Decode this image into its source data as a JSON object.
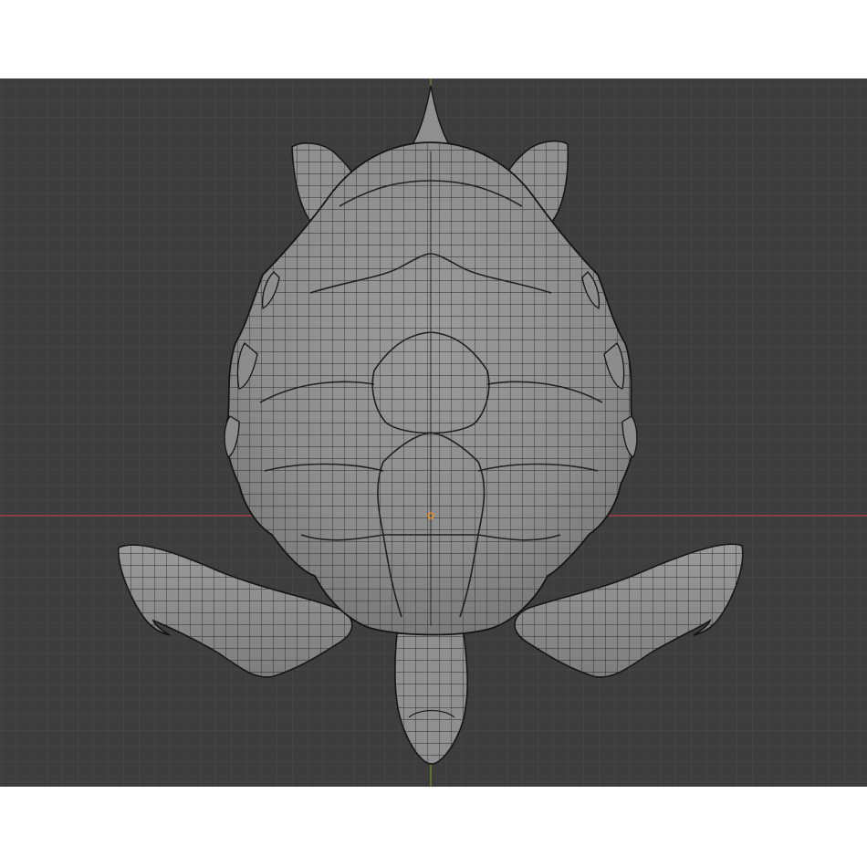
{
  "viewport": {
    "background_color": "#3d3d3d",
    "grid_minor_color": "#474747",
    "grid_major_color": "#515151",
    "x_axis_color": "#b3424b",
    "y_axis_color": "#6a8f2c",
    "mesh_fill_color": "#8e8e8e",
    "mesh_wire_color": "#2a2a2a",
    "mesh_outline_color": "#141414",
    "origin_marker_color": "#e98a2b",
    "view": "top-orthographic",
    "display_mode": "solid-with-wireframe-overlay"
  },
  "object": {
    "name": "turtle-mesh",
    "selected": false
  }
}
